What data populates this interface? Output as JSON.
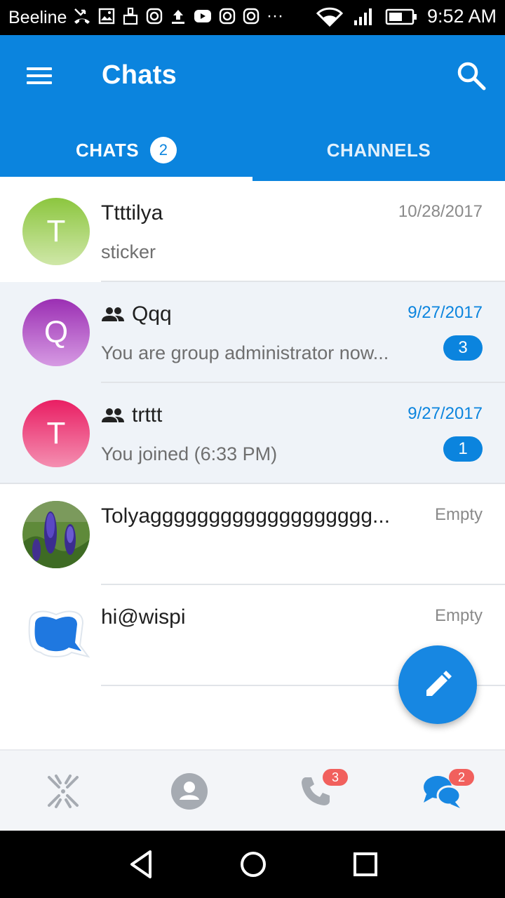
{
  "status_bar": {
    "carrier": "Beeline",
    "time": "9:52 AM",
    "notification_icons": [
      "missed-call-icon",
      "image-icon",
      "clean-icon",
      "instagram-icon",
      "upload-icon",
      "youtube-icon",
      "instagram-icon",
      "instagram-icon",
      "more-dots-icon"
    ],
    "more": "···"
  },
  "app_bar": {
    "title": "Chats",
    "tabs": [
      {
        "label": "CHATS",
        "badge": "2",
        "selected": true
      },
      {
        "label": "CHANNELS",
        "selected": false
      }
    ]
  },
  "chats": [
    {
      "name": "Ttttilya",
      "preview": "sticker",
      "date": "10/28/2017",
      "initial": "T",
      "avatar_color": "#8bc34a",
      "group": false,
      "unread": null,
      "highlighted": false
    },
    {
      "name": "Qqq",
      "preview": "You are group administrator now...",
      "date": "9/27/2017",
      "initial": "Q",
      "avatar_color": "#9c27b0",
      "group": true,
      "unread": "3",
      "highlighted": true
    },
    {
      "name": "trttt",
      "preview": "You joined (6:33 PM)",
      "date": "9/27/2017",
      "initial": "T",
      "avatar_color": "#e91e63",
      "group": true,
      "unread": "1",
      "highlighted": true
    },
    {
      "name": "Tolyaggggggggggggggggggg...",
      "preview": "",
      "date": "Empty",
      "initial": "",
      "avatar_color": "#4a7a2e",
      "group": false,
      "unread": null,
      "highlighted": false
    },
    {
      "name": "hi@wispi",
      "preview": "",
      "date": "Empty",
      "initial": "",
      "avatar_color": "#1e88e5",
      "group": false,
      "unread": null,
      "highlighted": false
    }
  ],
  "bottom_nav": [
    {
      "icon": "wispi-logo-icon",
      "badge": null
    },
    {
      "icon": "contacts-icon",
      "badge": null
    },
    {
      "icon": "phone-icon",
      "badge": "3"
    },
    {
      "icon": "chats-icon",
      "badge": "2",
      "active": true
    }
  ],
  "colors": {
    "primary": "#0b84de",
    "badge_red": "#f1605d",
    "highlight_row": "#eff3f8"
  }
}
